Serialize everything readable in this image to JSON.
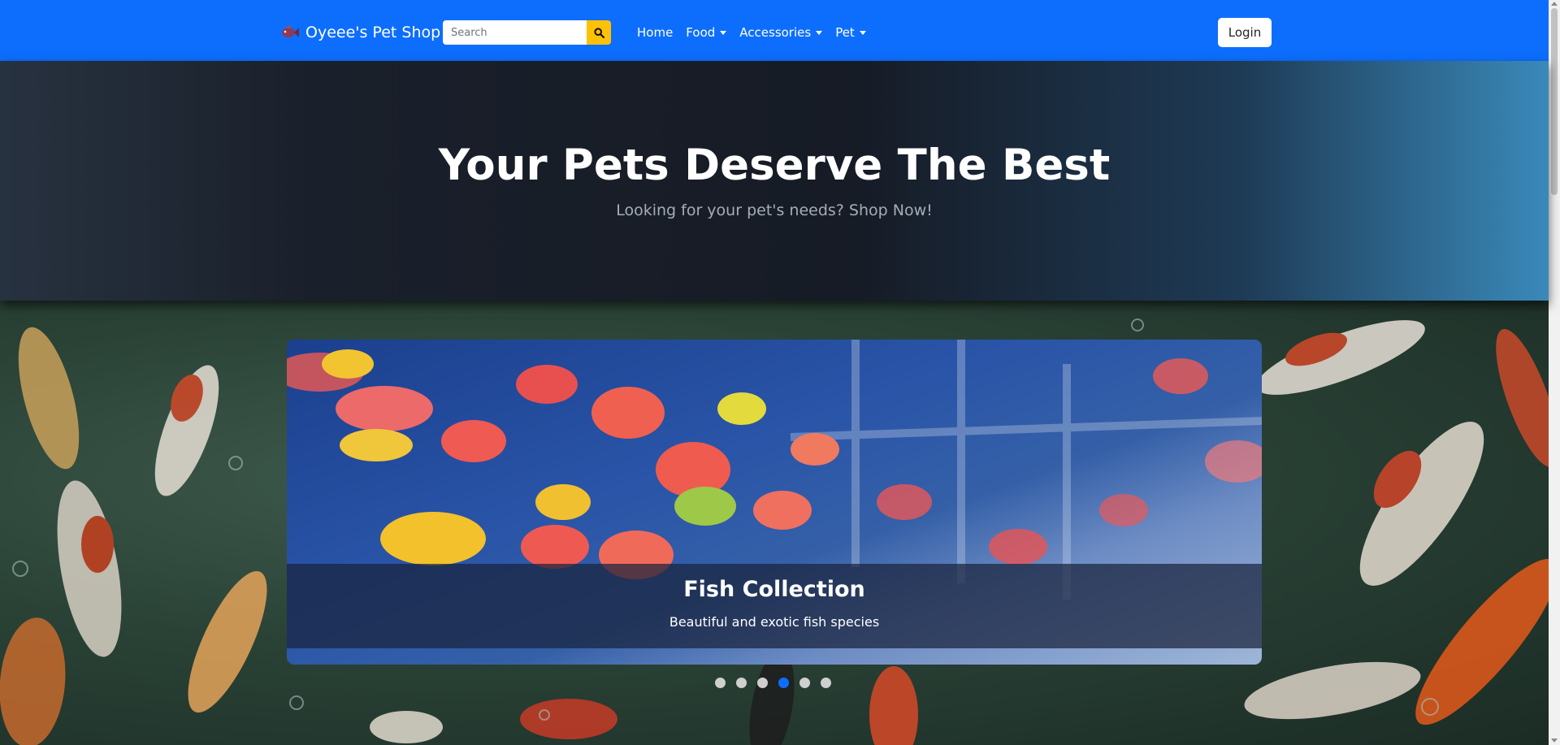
{
  "navbar": {
    "brand_name": "Oyeee's Pet Shop",
    "brand_icon": "fish-icon",
    "search_placeholder": "Search",
    "search_icon": "search-icon",
    "links": [
      {
        "label": "Home",
        "dropdown": false
      },
      {
        "label": "Food",
        "dropdown": true
      },
      {
        "label": "Accessories",
        "dropdown": true
      },
      {
        "label": "Pet",
        "dropdown": true
      }
    ],
    "login_label": "Login",
    "accent_color": "#0d6efd",
    "search_button_color": "#ffc107"
  },
  "hero": {
    "title": "Your Pets Deserve The Best",
    "subtitle": "Looking for your pet's needs? Shop Now!"
  },
  "carousel": {
    "slide_title": "Fish Collection",
    "slide_text": "Beautiful and exotic fish species",
    "indicator_count": 6,
    "active_index": 3
  }
}
